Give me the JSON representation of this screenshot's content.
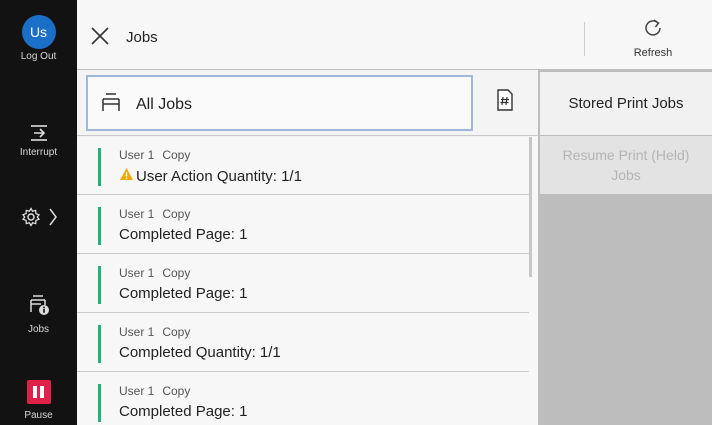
{
  "rail": {
    "avatar_initials": "Us",
    "logout_label": "Log Out",
    "interrupt_label": "Interrupt",
    "jobs_label": "Jobs",
    "pause_label": "Pause"
  },
  "header": {
    "title": "Jobs",
    "refresh_label": "Refresh"
  },
  "filter": {
    "label": "All Jobs"
  },
  "jobs": [
    {
      "user": "User 1",
      "type": "Copy",
      "status": "User Action",
      "detail": "Quantity: 1/1",
      "warning": true
    },
    {
      "user": "User 1",
      "type": "Copy",
      "status": "Completed",
      "detail": "Page: 1",
      "warning": false
    },
    {
      "user": "User 1",
      "type": "Copy",
      "status": "Completed",
      "detail": "Page: 1",
      "warning": false
    },
    {
      "user": "User 1",
      "type": "Copy",
      "status": "Completed",
      "detail": "Quantity: 1/1",
      "warning": false
    },
    {
      "user": "User 1",
      "type": "Copy",
      "status": "Completed",
      "detail": "Page: 1",
      "warning": false
    }
  ],
  "right_panel": {
    "stored_label": "Stored Print Jobs",
    "resume_label": "Resume Print (Held) Jobs"
  },
  "colors": {
    "accent_green": "#21b37a",
    "pause_red": "#e0204a",
    "avatar_blue": "#1b6fc7",
    "warning_amber": "#f0a800"
  },
  "icons": [
    "close-icon",
    "refresh-icon",
    "printer-stack-icon",
    "document-number-icon",
    "interrupt-icon",
    "gear-icon",
    "chevron-right-icon",
    "jobs-info-icon",
    "pause-icon",
    "warning-icon"
  ]
}
